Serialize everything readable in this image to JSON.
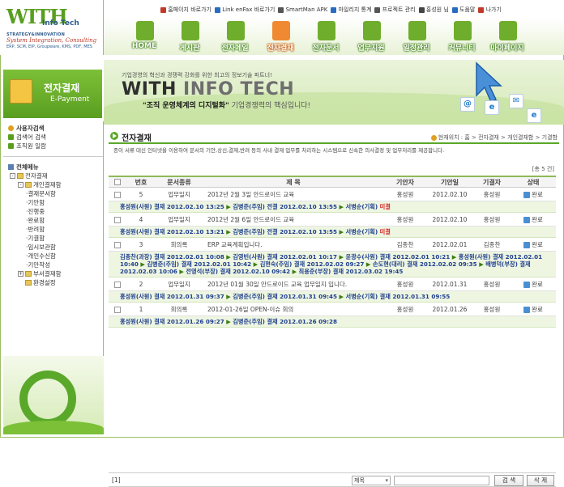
{
  "logo": {
    "mark": "WITH",
    "sub": "Info Tech",
    "line1": "STRATEGY&INNOVATION",
    "line2": "System Integration, Consulting",
    "line3": "ERP, SCM, EIP, Groupware, KMS, PDF, MES"
  },
  "toplinks": [
    {
      "icon": "home-icon",
      "color": "#c0392b",
      "label": "홈페이지 바로가기"
    },
    {
      "icon": "link-icon",
      "color": "#2a6bc2",
      "label": "Link enFax 바로가기"
    },
    {
      "icon": "android-icon",
      "color": "#555555",
      "label": "SmartMan APK"
    },
    {
      "icon": "chart-icon",
      "color": "#2a6bc2",
      "label": "마일리지 통계"
    },
    {
      "icon": "project-icon",
      "color": "#555555",
      "label": "프로젝트 관리"
    },
    {
      "icon": "user-icon",
      "color": "#444444",
      "label": "홍성원 님"
    },
    {
      "icon": "help-icon",
      "color": "#2a6bc2",
      "label": "도움말"
    },
    {
      "icon": "exit-icon",
      "color": "#c0392b",
      "label": "나가기"
    }
  ],
  "menu": [
    {
      "label": "HOME",
      "active": false
    },
    {
      "label": "게시판",
      "active": false
    },
    {
      "label": "전자메일",
      "active": false
    },
    {
      "label": "전자결재",
      "active": true
    },
    {
      "label": "전자문서",
      "active": false
    },
    {
      "label": "업무지원",
      "active": false
    },
    {
      "label": "일정관리",
      "active": false
    },
    {
      "label": "커뮤니티",
      "active": false
    },
    {
      "label": "마이페이지",
      "active": false
    }
  ],
  "section": {
    "title": "전자결재",
    "subtitle": "E-Payment"
  },
  "banner": {
    "line": "기업경영의 혁신과 경쟁력 강화를 위한 최고의 정보기술 파트너!",
    "title_a": "WITH",
    "title_b": "INFO TECH",
    "slogan_bold": "\"조직 운영체계의 디지털화\"",
    "slogan_rest": "기업경쟁력의 핵심입니다!"
  },
  "sidebar": {
    "top_items": [
      {
        "label": "사용자검색",
        "bold": true
      },
      {
        "label": "검색어 검색",
        "bold": false
      },
      {
        "label": "조직원 일람",
        "bold": false
      }
    ],
    "all_menu": "전체메뉴",
    "tree": [
      {
        "label": "전자결재",
        "level": 0,
        "sign": "-"
      },
      {
        "label": "개인결재함",
        "level": 1,
        "sign": "-"
      },
      {
        "label": "결재문서함",
        "level": 2,
        "sign": ""
      },
      {
        "label": "기안함",
        "level": 2,
        "sign": ""
      },
      {
        "label": "진행중",
        "level": 2,
        "sign": ""
      },
      {
        "label": "완료함",
        "level": 2,
        "sign": ""
      },
      {
        "label": "반려함",
        "level": 2,
        "sign": ""
      },
      {
        "label": "기결함",
        "level": 2,
        "sign": ""
      },
      {
        "label": "임시보관함",
        "level": 2,
        "sign": ""
      },
      {
        "label": "개인수신함",
        "level": 2,
        "sign": ""
      },
      {
        "label": "기안작성",
        "level": 2,
        "sign": ""
      },
      {
        "label": "부서결재함",
        "level": 1,
        "sign": "+"
      },
      {
        "label": "환경설정",
        "level": 1,
        "sign": ""
      }
    ]
  },
  "page": {
    "title": "전자결재",
    "breadcrumb": "현재위치 : 홈 > 전자결재 > 개인결재함 > 기결함",
    "description": "종이 서류 대신 인터넷을 이용하여 문서의 기안,상신,결재,반려 등의 사내 결재 업무를 처리하는 시스템으로 신속한 의사결정 및 업무처리를 제공합니다.",
    "count": "[총 5 건]"
  },
  "table": {
    "headers": [
      "번호",
      "문서종류",
      "제 목",
      "기안자",
      "기안일",
      "기결자",
      "상태"
    ],
    "rows": [
      {
        "no": "5",
        "type": "업무일지",
        "title": "2012년 2월 3일 안드로이드 교육",
        "writer": "홍성원",
        "date": "2012.02.10",
        "approver": "홍성원",
        "status": "완료",
        "flow": [
          {
            "t": "홍성원(사원) ",
            "c": ""
          },
          {
            "t": "결재",
            "c": "act"
          },
          {
            "t": " 2012.02.10 13:25 ",
            "c": ""
          },
          {
            "t": "▶",
            "c": "arrow"
          },
          {
            "t": " 김병준(주임) ",
            "c": ""
          },
          {
            "t": "전결",
            "c": "act"
          },
          {
            "t": " 2012.02.10 13:55 ",
            "c": ""
          },
          {
            "t": "▶",
            "c": "arrow"
          },
          {
            "t": " 서병순(기획) ",
            "c": ""
          },
          {
            "t": "미결",
            "c": "rej"
          }
        ]
      },
      {
        "no": "4",
        "type": "업무일지",
        "title": "2012년 2월 6일 안드로이드 교육",
        "writer": "홍성원",
        "date": "2012.02.10",
        "approver": "홍성원",
        "status": "완료",
        "flow": [
          {
            "t": "홍성원(사원) ",
            "c": ""
          },
          {
            "t": "결재",
            "c": "act"
          },
          {
            "t": " 2012.02.10 13:21 ",
            "c": ""
          },
          {
            "t": "▶",
            "c": "arrow"
          },
          {
            "t": " 김병준(주임) ",
            "c": ""
          },
          {
            "t": "전결",
            "c": "act"
          },
          {
            "t": " 2012.02.10 13:55 ",
            "c": ""
          },
          {
            "t": "▶",
            "c": "arrow"
          },
          {
            "t": " 서병순(기획) ",
            "c": ""
          },
          {
            "t": "미결",
            "c": "rej"
          }
        ]
      },
      {
        "no": "3",
        "type": "회의록",
        "title": "ERP 교육계획입니다.",
        "writer": "김종찬",
        "date": "2012.02.01",
        "approver": "김종찬",
        "status": "완료",
        "flow": [
          {
            "t": "김종찬(과장) ",
            "c": ""
          },
          {
            "t": "결재",
            "c": "act"
          },
          {
            "t": " 2012.02.01 10:08 ",
            "c": ""
          },
          {
            "t": "▶",
            "c": "arrow"
          },
          {
            "t": " 김영빈(사원) ",
            "c": ""
          },
          {
            "t": "결재",
            "c": "act"
          },
          {
            "t": " 2012.02.01 10:17 ",
            "c": ""
          },
          {
            "t": "▶",
            "c": "arrow"
          },
          {
            "t": " 윤광수(사원) ",
            "c": ""
          },
          {
            "t": "결재",
            "c": "act"
          },
          {
            "t": " 2012.02.01 10:21 ",
            "c": ""
          },
          {
            "t": "▶",
            "c": "arrow"
          },
          {
            "t": " 홍성원(사원) ",
            "c": ""
          },
          {
            "t": "결재",
            "c": "act"
          },
          {
            "t": " 2012.02.01 10:40 ",
            "c": ""
          },
          {
            "t": "▶",
            "c": "arrow"
          },
          {
            "t": " 김병준(주임) ",
            "c": ""
          },
          {
            "t": "결재",
            "c": "act"
          },
          {
            "t": " 2012.02.01 10:42 ",
            "c": ""
          },
          {
            "t": "▶",
            "c": "arrow"
          },
          {
            "t": " 김현숙(주임) ",
            "c": ""
          },
          {
            "t": "결재",
            "c": "act"
          },
          {
            "t": " 2012.02.02 09:27 ",
            "c": ""
          },
          {
            "t": "▶",
            "c": "arrow"
          },
          {
            "t": " 손도현(대리) ",
            "c": ""
          },
          {
            "t": "결재",
            "c": "act"
          },
          {
            "t": " 2012.02.02 09:35 ",
            "c": ""
          },
          {
            "t": "▶",
            "c": "arrow"
          },
          {
            "t": " 배병덕(부장) ",
            "c": ""
          },
          {
            "t": "결재",
            "c": "act"
          },
          {
            "t": " 2012.02.03 10:06 ",
            "c": ""
          },
          {
            "t": "▶",
            "c": "arrow"
          },
          {
            "t": " 전영석(부장) ",
            "c": ""
          },
          {
            "t": "결재",
            "c": "act"
          },
          {
            "t": " 2012.02.10 09:42 ",
            "c": ""
          },
          {
            "t": "▶",
            "c": "arrow"
          },
          {
            "t": " 최용준(부장) ",
            "c": ""
          },
          {
            "t": "결재",
            "c": "act"
          },
          {
            "t": " 2012.03.02 19:45",
            "c": ""
          }
        ]
      },
      {
        "no": "2",
        "type": "업무일지",
        "title": "2012년 01월 30일 안드로이드 교육 업무일지 입니다.",
        "writer": "홍성원",
        "date": "2012.01.31",
        "approver": "홍성원",
        "status": "완료",
        "flow": [
          {
            "t": "홍성원(사원) ",
            "c": ""
          },
          {
            "t": "결재",
            "c": "act"
          },
          {
            "t": " 2012.01.31 09:37 ",
            "c": ""
          },
          {
            "t": "▶",
            "c": "arrow"
          },
          {
            "t": " 김병준(주임) ",
            "c": ""
          },
          {
            "t": "결재",
            "c": "act"
          },
          {
            "t": " 2012.01.31 09:45 ",
            "c": ""
          },
          {
            "t": "▶",
            "c": "arrow"
          },
          {
            "t": " 서병순(기획) ",
            "c": ""
          },
          {
            "t": "결재",
            "c": "act"
          },
          {
            "t": " 2012.01.31 09:55",
            "c": ""
          }
        ]
      },
      {
        "no": "1",
        "type": "회의록",
        "title": "2012-01-26일 OPEN-이슈 회의",
        "writer": "홍성원",
        "date": "2012.01.26",
        "approver": "홍성원",
        "status": "완료",
        "flow": [
          {
            "t": "홍성원(사원) ",
            "c": ""
          },
          {
            "t": "결재",
            "c": "act"
          },
          {
            "t": " 2012.01.26 09:27 ",
            "c": ""
          },
          {
            "t": "▶",
            "c": "arrow"
          },
          {
            "t": " 김병준(주임) ",
            "c": ""
          },
          {
            "t": "결재",
            "c": "act"
          },
          {
            "t": " 2012.01.26 09:28",
            "c": ""
          }
        ]
      }
    ]
  },
  "footer": {
    "pager": "[1]",
    "search_field": "제목",
    "search_value": "",
    "search_button": "검 색",
    "delete_button": "삭 제"
  }
}
